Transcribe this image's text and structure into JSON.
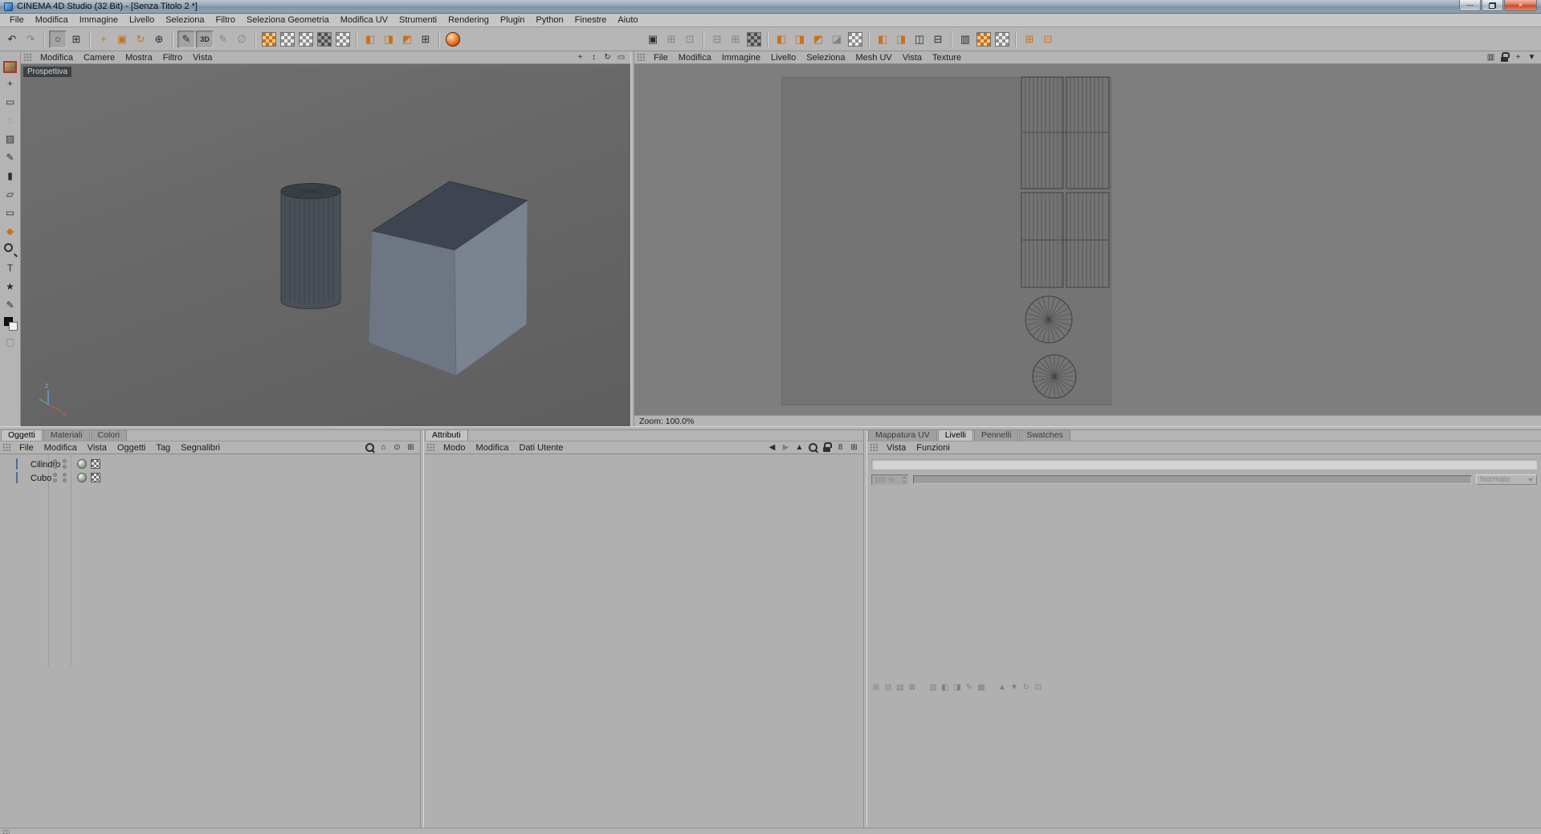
{
  "window": {
    "title": "CINEMA 4D Studio (32 Bit) - [Senza Titolo 2 *]",
    "min_glyph": "—",
    "close_glyph": "×"
  },
  "menubar": [
    "File",
    "Modifica",
    "Immagine",
    "Livello",
    "Seleziona",
    "Filtro",
    "Seleziona Geometria",
    "Modifica UV",
    "Strumenti",
    "Rendering",
    "Plugin",
    "Python",
    "Finestre",
    "Aiuto"
  ],
  "toolbar": {
    "left": [
      [
        {
          "name": "undo-icon",
          "glyph": "↶"
        },
        {
          "name": "redo-icon",
          "glyph": "↷",
          "cls": "dim"
        }
      ],
      [
        {
          "name": "live-selection-icon",
          "glyph": "○",
          "cls": "pressed"
        },
        {
          "name": "frame-selection-icon",
          "glyph": "⊞"
        }
      ],
      [
        {
          "name": "move-tool-icon",
          "glyph": "+",
          "cls": "accent"
        },
        {
          "name": "scale-tool-icon",
          "glyph": "▣",
          "cls": "accent"
        },
        {
          "name": "rotate-tool-icon",
          "glyph": "↻",
          "cls": "accent"
        },
        {
          "name": "coordinate-system-icon",
          "glyph": "⊕"
        }
      ],
      [
        {
          "name": "paint-brush-icon",
          "glyph": "✎",
          "cls": "pressed"
        },
        {
          "name": "projection-3d-icon",
          "glyph": "3D",
          "cls": "pressed small-text"
        },
        {
          "name": "airbrush-icon",
          "glyph": "✎",
          "cls": "dim"
        },
        {
          "name": "no-paint-icon",
          "glyph": "∅",
          "cls": "dim"
        }
      ],
      [
        {
          "name": "paint-setup-wizard-icon",
          "cls": "checker orange"
        },
        {
          "name": "texture-paint-icon",
          "cls": "checker"
        },
        {
          "name": "multi-channel-icon",
          "cls": "checker"
        },
        {
          "name": "projection-paint-icon",
          "cls": "checker dark"
        },
        {
          "name": "raybrush-icon",
          "cls": "checker"
        }
      ],
      [
        {
          "name": "layout-columns-icon",
          "glyph": "◧",
          "cls": "accent"
        },
        {
          "name": "layout-rows-icon",
          "glyph": "◨",
          "cls": "accent"
        },
        {
          "name": "layout-tabs-icon",
          "glyph": "◩",
          "cls": "accent"
        },
        {
          "name": "layout-grid-icon",
          "glyph": "⊞"
        }
      ],
      [
        {
          "name": "render-view-icon",
          "cls": "sphere"
        }
      ]
    ],
    "right": [
      [
        {
          "name": "uv-point-mode-icon",
          "glyph": "▣"
        },
        {
          "name": "uv-edge-mode-icon",
          "glyph": "⊞",
          "cls": "dim"
        },
        {
          "name": "uv-polygon-mode-icon",
          "glyph": "⊡",
          "cls": "dim"
        }
      ],
      [
        {
          "name": "uv-select-connected-icon",
          "glyph": "⊟",
          "cls": "dim"
        },
        {
          "name": "uv-select-all-icon",
          "glyph": "⊞",
          "cls": "dim"
        },
        {
          "name": "uv-checkerboard-icon",
          "cls": "checker dark"
        }
      ],
      [
        {
          "name": "uv-move-icon",
          "glyph": "◧",
          "cls": "accent"
        },
        {
          "name": "uv-scale-icon",
          "glyph": "◨",
          "cls": "accent"
        },
        {
          "name": "uv-rotate-icon",
          "glyph": "◩",
          "cls": "accent"
        },
        {
          "name": "uv-mirror-icon",
          "glyph": "◪",
          "cls": "dim"
        },
        {
          "name": "uv-pattern-icon",
          "cls": "checker"
        }
      ],
      [
        {
          "name": "uv-layout-a-icon",
          "glyph": "◧",
          "cls": "accent"
        },
        {
          "name": "uv-layout-b-icon",
          "glyph": "◨",
          "cls": "accent"
        },
        {
          "name": "uv-layout-c-icon",
          "glyph": "◫"
        },
        {
          "name": "uv-layout-d-icon",
          "glyph": "⊟"
        }
      ],
      [
        {
          "name": "uv-pin-icon",
          "glyph": "▥"
        },
        {
          "name": "uv-relax-icon",
          "cls": "checker orange"
        },
        {
          "name": "uv-pack-icon",
          "cls": "checker"
        }
      ],
      [
        {
          "name": "uv-apply-icon",
          "glyph": "⊞",
          "cls": "accent"
        },
        {
          "name": "uv-bake-icon",
          "glyph": "⊡",
          "cls": "accent"
        }
      ]
    ]
  },
  "palette": {
    "items": [
      {
        "name": "brush-preview-icon",
        "cls": "pic"
      },
      {
        "name": "transform-tool-icon",
        "glyph": "+"
      },
      {
        "name": "rect-selection-icon",
        "glyph": "▭"
      },
      {
        "name": "lasso-selection-icon",
        "glyph": "◌",
        "cls": "dim"
      },
      {
        "name": "magic-wand-icon",
        "glyph": "▨"
      },
      {
        "name": "draw-pencil-icon",
        "glyph": "✎"
      },
      {
        "name": "stamp-tool-icon",
        "glyph": "▮"
      },
      {
        "name": "eraser-tool-icon",
        "glyph": "▱"
      },
      {
        "name": "crop-tool-icon",
        "glyph": "▭"
      },
      {
        "name": "fill-bucket-icon",
        "glyph": "◆",
        "cls": "accent"
      },
      {
        "name": "magnify-tool-icon",
        "cls": "mag"
      },
      {
        "name": "text-tool-icon",
        "glyph": "T"
      },
      {
        "name": "star-shape-icon",
        "glyph": "★"
      },
      {
        "name": "eyedropper-icon",
        "glyph": "✎"
      },
      {
        "name": "color-swatch-icon",
        "cls": "swatch"
      },
      {
        "name": "empty-slot-icon",
        "glyph": "▢",
        "cls": "dim"
      }
    ]
  },
  "viewport": {
    "label": "Prospettiva",
    "menus": [
      "Modifica",
      "Camere",
      "Mostra",
      "Filtro",
      "Vista"
    ],
    "nav_icons": [
      {
        "name": "pan-view-icon",
        "glyph": "+"
      },
      {
        "name": "dolly-view-icon",
        "glyph": "↕"
      },
      {
        "name": "rotate-view-icon",
        "glyph": "↻"
      },
      {
        "name": "toggle-view-icon",
        "glyph": "▭"
      }
    ]
  },
  "uv": {
    "menus": [
      "File",
      "Modifica",
      "Immagine",
      "Livello",
      "Seleziona",
      "Mesh UV",
      "Vista",
      "Texture"
    ],
    "nav_icons": [
      {
        "name": "uv-info-icon",
        "glyph": "▥"
      },
      {
        "name": "uv-lock-icon",
        "cls": "lock"
      },
      {
        "name": "uv-pan-icon",
        "glyph": "+"
      },
      {
        "name": "panel-menu-icon",
        "glyph": "▼"
      }
    ],
    "zoom": "Zoom: 100.0%"
  },
  "objects": {
    "tabs": [
      {
        "label": "Oggetti",
        "cls": "active"
      },
      {
        "label": "Materiali"
      },
      {
        "label": "Colori"
      }
    ],
    "menus": [
      "File",
      "Modifica",
      "Vista",
      "Oggetti",
      "Tag",
      "Segnalibri"
    ],
    "header_icons": [
      {
        "name": "search-icon",
        "cls": "mag"
      },
      {
        "name": "path-home-icon",
        "glyph": "⌂"
      },
      {
        "name": "filter-visibility-icon",
        "glyph": "⊙"
      },
      {
        "name": "add-panel-icon",
        "glyph": "⊞"
      }
    ],
    "items": [
      {
        "label": "Cilindro",
        "type": "t-cylinder"
      },
      {
        "label": "Cubo",
        "type": "t-cube"
      }
    ]
  },
  "attributes": {
    "tabs": [
      {
        "label": "Attributi",
        "cls": "active"
      }
    ],
    "menus": [
      "Modo",
      "Modifica",
      "Dati Utente"
    ],
    "header_icons": [
      {
        "name": "back-icon",
        "glyph": "◀"
      },
      {
        "name": "forward-icon",
        "glyph": "▶",
        "cls": "dim"
      },
      {
        "name": "up-icon",
        "glyph": "▲"
      },
      {
        "name": "search-icon",
        "cls": "mag"
      },
      {
        "name": "lock-icon",
        "cls": "lock"
      },
      {
        "name": "history-icon",
        "glyph": "8"
      },
      {
        "name": "new-panel-icon",
        "glyph": "⊞"
      }
    ]
  },
  "layers": {
    "tabs": [
      {
        "label": "Mappatura UV"
      },
      {
        "label": "Livelli",
        "cls": "active"
      },
      {
        "label": "Pennelli"
      },
      {
        "label": "Swatches"
      }
    ],
    "menus": [
      "Vista",
      "Funzioni"
    ],
    "opacity": "100 %",
    "blend": "Normale",
    "strip": [
      [
        {
          "name": "new-layer-icon",
          "glyph": "⊞",
          "cls": "dim"
        },
        {
          "name": "new-folder-icon",
          "glyph": "⊟",
          "cls": "dim"
        },
        {
          "name": "duplicate-layer-icon",
          "glyph": "▤",
          "cls": "dim"
        },
        {
          "name": "delete-layer-icon",
          "glyph": "⊠",
          "cls": "dim"
        }
      ],
      [
        {
          "name": "merge-down-icon",
          "glyph": "▥",
          "cls": "dim"
        },
        {
          "name": "layer-mask-icon",
          "glyph": "◧",
          "cls": "dim"
        },
        {
          "name": "alpha-channel-icon",
          "glyph": "◨",
          "cls": "dim"
        },
        {
          "name": "layer-effect-icon",
          "glyph": "✎",
          "cls": "dim"
        },
        {
          "name": "adjustment-icon",
          "glyph": "▦",
          "cls": "dim"
        }
      ],
      [
        {
          "name": "move-layer-up-icon",
          "glyph": "▲",
          "cls": "dim"
        },
        {
          "name": "move-layer-down-icon",
          "glyph": "▼",
          "cls": "dim"
        },
        {
          "name": "refresh-icon",
          "glyph": "↻",
          "cls": "dim"
        },
        {
          "name": "layer-settings-icon",
          "glyph": "⊡",
          "cls": "dim"
        }
      ]
    ]
  },
  "colors": {
    "accent_orange": "#c9701d",
    "chrome": "#b4b4b4",
    "viewport_bg": "#676767",
    "uv_bg": "#7e7e7e",
    "uv_canvas": "#747474",
    "wireframe": "#3f3f3f",
    "cube_top": "#3e4551",
    "cube_left": "#6e7683",
    "cube_right": "#7b8390",
    "cylinder_body": "#4b5058"
  }
}
